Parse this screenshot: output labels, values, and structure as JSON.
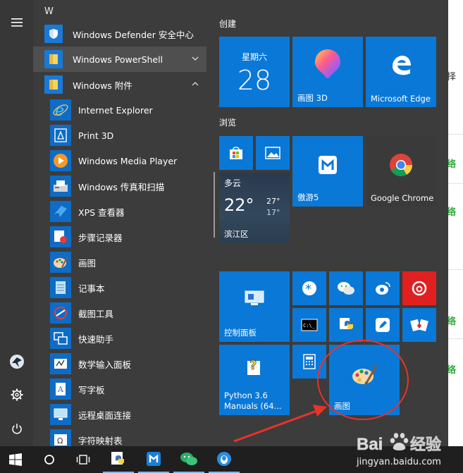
{
  "background_page": {
    "snippet_1": "择",
    "snippet_2": "络",
    "snippet_3": "络",
    "snippet_4": "络",
    "snippet_5": "络"
  },
  "app_list": {
    "section_letter": "W",
    "items": [
      {
        "label": "Windows Defender 安全中心",
        "icon": "shield-icon"
      },
      {
        "label": "Windows PowerShell",
        "icon": "folder-icon"
      },
      {
        "label": "Windows 附件",
        "icon": "folder-icon"
      },
      {
        "label": "Internet Explorer",
        "icon": "internet-explorer-icon"
      },
      {
        "label": "Print 3D",
        "icon": "print-3d-icon"
      },
      {
        "label": "Windows Media Player",
        "icon": "media-player-icon"
      },
      {
        "label": "Windows 传真和扫描",
        "icon": "fax-scan-icon"
      },
      {
        "label": "XPS 查看器",
        "icon": "xps-viewer-icon"
      },
      {
        "label": "步骤记录器",
        "icon": "steps-recorder-icon"
      },
      {
        "label": "画图",
        "icon": "paint-icon"
      },
      {
        "label": "记事本",
        "icon": "notepad-icon"
      },
      {
        "label": "截图工具",
        "icon": "snipping-tool-icon"
      },
      {
        "label": "快速助手",
        "icon": "quick-assist-icon"
      },
      {
        "label": "数学输入面板",
        "icon": "math-input-icon"
      },
      {
        "label": "写字板",
        "icon": "wordpad-icon"
      },
      {
        "label": "远程桌面连接",
        "icon": "remote-desktop-icon"
      },
      {
        "label": "字符映射表",
        "icon": "character-map-icon"
      }
    ]
  },
  "groups": {
    "create": "创建",
    "browse": "浏览"
  },
  "tiles": {
    "calendar": {
      "weekday": "星期六",
      "day": "28"
    },
    "paint3d": "画图 3D",
    "edge": "Microsoft Edge",
    "weather": {
      "condition": "多云",
      "temp": "22°",
      "high": "27°",
      "low": "17°",
      "location": "滨江区"
    },
    "maxthon": "傲游5",
    "chrome": "Google Chrome",
    "control_panel": "控制面板",
    "python_manuals": "Python 3.6 Manuals (64...",
    "paint": "画图"
  },
  "annotation": {
    "color": "#e8332a"
  },
  "watermark": {
    "brand": "Bai",
    "brand_tail": "经验",
    "url": "jingyan.baidu.com"
  },
  "colors": {
    "tile_blue": "#0a78d7",
    "start_bg": "#3c3c3c",
    "taskbar_bg": "#1f1f1f"
  }
}
